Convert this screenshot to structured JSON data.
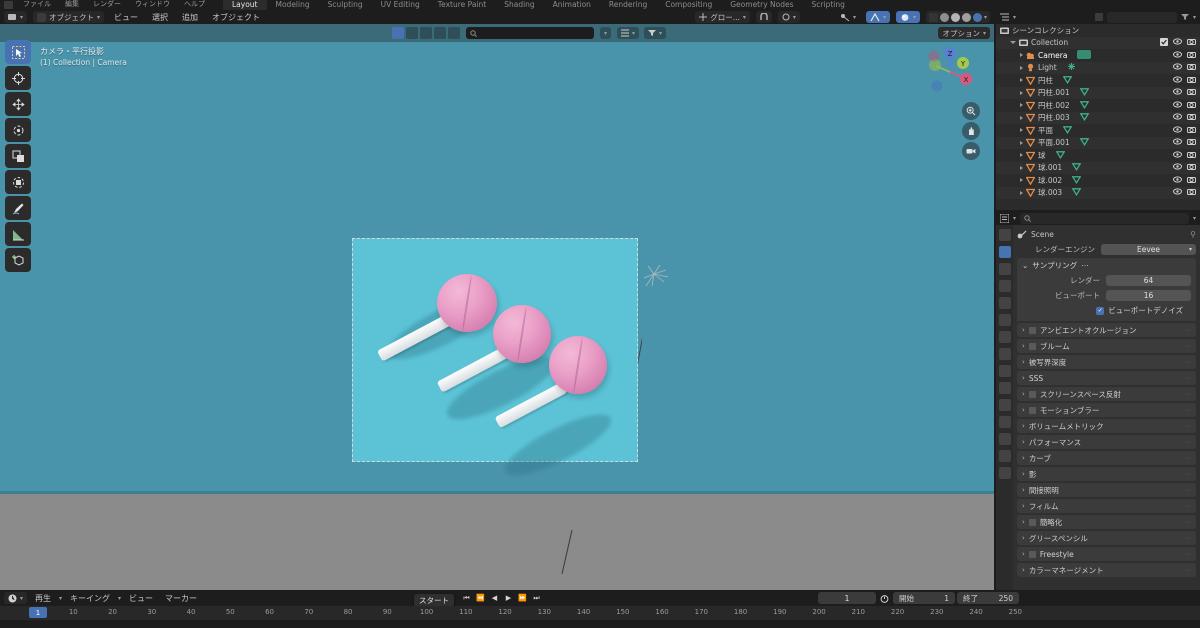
{
  "app": {
    "title": "Blender",
    "topbar": {
      "menus": [
        "ファイル",
        "編集",
        "レンダー",
        "ウィンドウ",
        "ヘルプ"
      ],
      "tabs": [
        {
          "label": "Layout",
          "active": true
        },
        {
          "label": "Modeling",
          "active": false
        },
        {
          "label": "Sculpting",
          "active": false
        },
        {
          "label": "UV Editing",
          "active": false
        },
        {
          "label": "Texture Paint",
          "active": false
        },
        {
          "label": "Shading",
          "active": false
        },
        {
          "label": "Animation",
          "active": false
        },
        {
          "label": "Rendering",
          "active": false
        },
        {
          "label": "Compositing",
          "active": false
        },
        {
          "label": "Geometry Nodes",
          "active": false
        },
        {
          "label": "Scripting",
          "active": false
        }
      ]
    }
  },
  "viewport": {
    "header": {
      "mode": "オブジェクト",
      "menus": [
        "ビュー",
        "選択",
        "追加",
        "オブジェクト"
      ],
      "transform_pivot": "グロー...",
      "snap_label": "",
      "options_label": "オプション"
    },
    "overlay": {
      "line1": "カメラ・平行投影",
      "line2": "(1) Collection | Camera"
    },
    "gizmo_axes": [
      "X",
      "Y",
      "Z"
    ],
    "nav_buttons": [
      "zoom-icon",
      "hand-icon",
      "camera-icon"
    ],
    "tools": [
      {
        "name": "tweak-select-box",
        "active": true
      },
      {
        "name": "cursor",
        "active": false
      },
      {
        "name": "move",
        "active": false
      },
      {
        "name": "rotate",
        "active": false
      },
      {
        "name": "scale",
        "active": false
      },
      {
        "name": "transform",
        "active": false
      },
      {
        "name": "annotate",
        "active": false
      },
      {
        "name": "measure",
        "active": false
      },
      {
        "name": "add-cube",
        "active": false
      }
    ],
    "render": {
      "background_color": "#5cc3d6",
      "candy_color": "#e39dc6",
      "stick_color": "#f2f4f5",
      "object_count": 3,
      "object_description": "ロリポップ"
    }
  },
  "outliner": {
    "title": "シーンコレクション",
    "search_placeholder": "",
    "rows": [
      {
        "label": "シーンコレクション",
        "depth": 0,
        "icon": "collection-icon",
        "expander": "none",
        "has_toggles": false
      },
      {
        "label": "Collection",
        "depth": 1,
        "icon": "collection-icon",
        "expander": "open",
        "has_toggles": true,
        "checkbox": true
      },
      {
        "label": "Camera",
        "depth": 2,
        "icon": "camera-data-icon",
        "expander": "closed",
        "has_toggles": true,
        "selected": true
      },
      {
        "label": "Light",
        "depth": 2,
        "icon": "light-icon",
        "expander": "closed",
        "has_toggles": true
      },
      {
        "label": "円柱",
        "depth": 2,
        "icon": "mesh-icon",
        "expander": "closed",
        "has_toggles": true
      },
      {
        "label": "円柱.001",
        "depth": 2,
        "icon": "mesh-icon",
        "expander": "closed",
        "has_toggles": true
      },
      {
        "label": "円柱.002",
        "depth": 2,
        "icon": "mesh-icon",
        "expander": "closed",
        "has_toggles": true
      },
      {
        "label": "円柱.003",
        "depth": 2,
        "icon": "mesh-icon",
        "expander": "closed",
        "has_toggles": true
      },
      {
        "label": "平面",
        "depth": 2,
        "icon": "mesh-icon",
        "expander": "closed",
        "has_toggles": true
      },
      {
        "label": "平面.001",
        "depth": 2,
        "icon": "mesh-icon",
        "expander": "closed",
        "has_toggles": true
      },
      {
        "label": "球",
        "depth": 2,
        "icon": "mesh-icon",
        "expander": "closed",
        "has_toggles": true
      },
      {
        "label": "球.001",
        "depth": 2,
        "icon": "mesh-icon",
        "expander": "closed",
        "has_toggles": true
      },
      {
        "label": "球.002",
        "depth": 2,
        "icon": "mesh-icon",
        "expander": "closed",
        "has_toggles": true
      },
      {
        "label": "球.003",
        "depth": 2,
        "icon": "mesh-icon",
        "expander": "closed",
        "has_toggles": true
      }
    ]
  },
  "properties": {
    "breadcrumb": "Scene",
    "search_placeholder": "",
    "render_engine": {
      "label": "レンダーエンジン",
      "value": "Eevee"
    },
    "sampling": {
      "title": "サンプリング",
      "render": {
        "label": "レンダー",
        "value": "64"
      },
      "viewport": {
        "label": "ビューポート",
        "value": "16"
      },
      "denoise": {
        "label": "ビューポートデノイズ",
        "checked": true
      }
    },
    "panels": [
      {
        "label": "アンビエントオクルージョン",
        "checkbox": true
      },
      {
        "label": "ブルーム",
        "checkbox": true
      },
      {
        "label": "被写界深度",
        "checkbox": false
      },
      {
        "label": "SSS",
        "checkbox": false
      },
      {
        "label": "スクリーンスペース反射",
        "checkbox": true
      },
      {
        "label": "モーションブラー",
        "checkbox": true
      },
      {
        "label": "ボリュームメトリック",
        "checkbox": false
      },
      {
        "label": "パフォーマンス",
        "checkbox": false
      },
      {
        "label": "カーブ",
        "checkbox": false
      },
      {
        "label": "影",
        "checkbox": false
      },
      {
        "label": "間接照明",
        "checkbox": false
      },
      {
        "label": "フィルム",
        "checkbox": false
      },
      {
        "label": "簡略化",
        "checkbox": true
      },
      {
        "label": "グリースペンシル",
        "checkbox": false
      },
      {
        "label": "Freestyle",
        "checkbox": true
      },
      {
        "label": "カラーマネージメント",
        "checkbox": false
      }
    ]
  },
  "timeline": {
    "menus": [
      "再生",
      "キーイング",
      "ビュー",
      "マーカー"
    ],
    "tooltip": "スタート",
    "playback_buttons": [
      "jump-start-icon",
      "prev-keyframe-icon",
      "play-reverse-icon",
      "play-icon",
      "next-keyframe-icon",
      "jump-end-icon"
    ],
    "current_frame": "1",
    "start": {
      "label": "開始",
      "value": "1"
    },
    "end": {
      "label": "終了",
      "value": "250"
    },
    "ruler_ticks": [
      "10",
      "20",
      "30",
      "40",
      "50",
      "60",
      "70",
      "80",
      "90",
      "100",
      "110",
      "120",
      "130",
      "140",
      "150",
      "160",
      "170",
      "180",
      "190",
      "200",
      "210",
      "220",
      "230",
      "240",
      "250"
    ],
    "playhead_frame": "1"
  }
}
